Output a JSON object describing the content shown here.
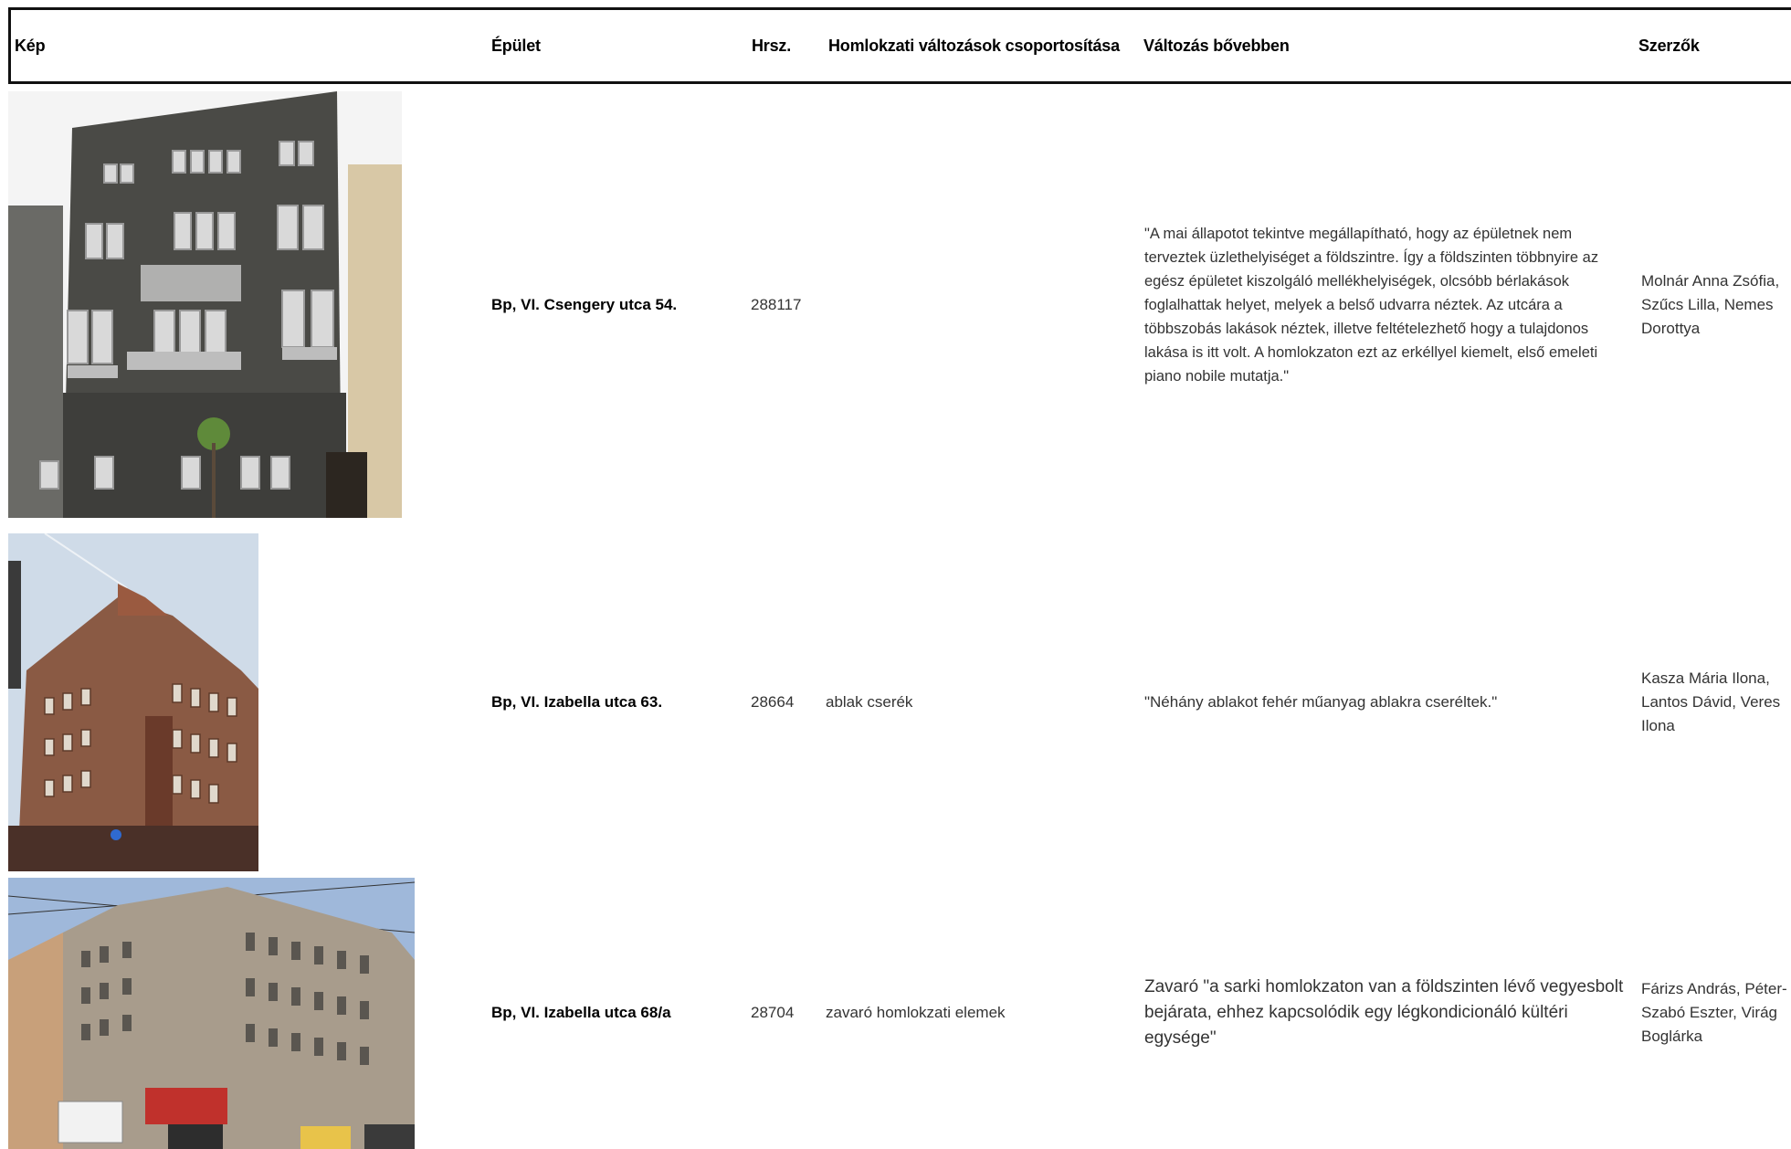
{
  "table": {
    "headers": {
      "image": "Kép",
      "building": "Épület",
      "lot": "Hrsz.",
      "grouping": "Homlokzati változások csoportosítása",
      "details": "Változás bővebben",
      "authors": "Szerzők"
    },
    "rows": [
      {
        "building": "Bp, VI. Csengery utca 54.",
        "lot": "288117",
        "grouping": "",
        "details": "\"A mai állapotot tekintve megállapítható, hogy az épületnek nem terveztek üzlethelyiséget a földszintre. Így a földszinten többnyire az egész épületet kiszolgáló mellékhelyiségek, olcsóbb bérlakások foglalhattak helyet, melyek a belső udvarra néztek. Az utcára a többszobás lakások néztek, illetve feltételezhető hogy a tulajdonos lakása is itt volt. A homlokzaton ezt az erkéllyel kiemelt, első emeleti piano nobile mutatja.\"",
        "authors": "Molnár Anna Zsófia, Szűcs Lilla, Nemes Dorottya"
      },
      {
        "building": "Bp, VI. Izabella utca 63.",
        "lot": "28664",
        "grouping": "ablak cserék",
        "details": "\"Néhány ablakot fehér műanyag ablakra cseréltek.\"",
        "authors": "Kasza Mária Ilona, Lantos Dávid, Veres Ilona"
      },
      {
        "building": "Bp, VI. Izabella utca 68/a",
        "lot": "28704",
        "grouping": "zavaró homlokzati elemek",
        "details": "Zavaró \"a sarki homlokzaton van a földszinten lévő vegyesbolt bejárata, ehhez kapcsolódik egy légkondicionáló kültéri egysége\"",
        "authors": "Fárizs András, Péter-Szabó Eszter, Virág Boglárka"
      }
    ]
  },
  "colors": {
    "header_border": "#111111",
    "facade_dark": "#4a4a46",
    "facade_brick": "#8a5a44",
    "facade_light": "#a89c8c",
    "sky": "#cfdbe8"
  }
}
